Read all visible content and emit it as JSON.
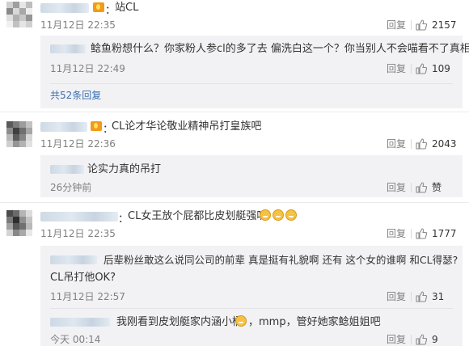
{
  "comments": [
    {
      "name_hidden": true,
      "text": "站CL",
      "time": "11月12日 22:35",
      "reply_label": "回复",
      "likes": "2157",
      "sub_replies": [
        {
          "text": "鲶鱼粉想什么？你家粉人参cl的多了去 偏洗白这一个？你当别人不会喵看不了真相？",
          "time": "11月12日 22:49",
          "reply_label": "回复",
          "likes": "109"
        }
      ],
      "more_link": "共52条回复"
    },
    {
      "text": "CL论才华论敬业精神吊打皇族吧",
      "time": "11月12日 22:36",
      "reply_label": "回复",
      "likes": "2043",
      "sub_replies": [
        {
          "text": "论实力真的吊打",
          "time": "26分钟前",
          "reply_label": "回复",
          "likes": "赞"
        }
      ]
    },
    {
      "text": "CL女王放个屁都比皮划艇强叭",
      "time": "11月12日 22:35",
      "reply_label": "回复",
      "likes": "1777",
      "sub_replies": [
        {
          "text_line1": "后辈粉丝敢这么说同公司的前辈 真是挺有礼貌啊 还有 这个女的谁啊 和CL得瑟?",
          "text_line2": "CL吊打他OK?",
          "time": "11月12日 22:57",
          "reply_label": "回复",
          "likes": "31"
        },
        {
          "text_before": "我刚看到皮划艇家内涵小桶",
          "text_after": "，mmp，管好她家鲶姐姐吧",
          "time": "今天 00:14",
          "reply_label": "回复",
          "likes": "9"
        }
      ]
    }
  ],
  "icons": {
    "like": "thumbs-up-icon",
    "badge": "member-badge-icon",
    "emoji": "grin-emoji-icon"
  },
  "colors": {
    "time": "#808080",
    "link": "#3a6fb0",
    "sub_bg": "#f2f2f5"
  }
}
